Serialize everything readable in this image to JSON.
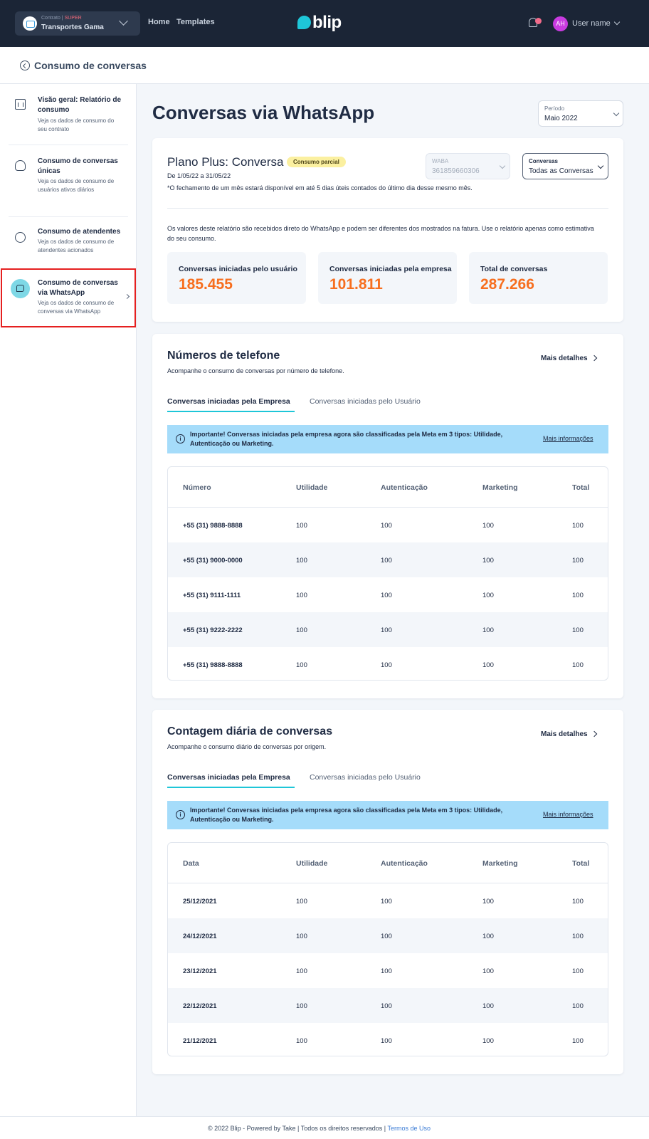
{
  "header": {
    "contract_label": "Contrato |",
    "contract_tier": "SUPER",
    "contract_name": "Transportes Gama",
    "nav": [
      "Home",
      "Templates"
    ],
    "logo": "blip",
    "avatar_initials": "AH",
    "username": "User name"
  },
  "breadcrumb": {
    "title": "Consumo de conversas"
  },
  "sidebar": {
    "items": [
      {
        "title": "Visão geral: Relatório de consumo",
        "desc": "Veja os dados de consumo do seu contrato"
      },
      {
        "title": "Consumo de conversas únicas",
        "desc": "Veja os dados de consumo de usuários ativos diários"
      },
      {
        "title": "Consumo de atendentes",
        "desc": "Veja os dados de consumo de atendentes acionados"
      },
      {
        "title": "Consumo de conversas via WhatsApp",
        "desc": "Veja os dados de consumo de conversas via WhatsApp"
      }
    ]
  },
  "page": {
    "title": "Conversas via WhatsApp",
    "period": {
      "label": "Período",
      "value": "Maio 2022"
    }
  },
  "plan": {
    "title": "Plano Plus: Conversa",
    "badge": "Consumo parcial",
    "range": "De 1/05/22 a 31/05/22",
    "note": "*O fechamento de um mês estará disponível em até 5 dias úteis contados do último dia desse mesmo mês.",
    "waba": {
      "label": "WABA",
      "value": "361859660306"
    },
    "conversas": {
      "label": "Conversas",
      "value": "Todas as Conversas"
    },
    "disclaimer": "Os valores deste relatório são recebidos direto do WhatsApp e podem ser diferentes dos mostrados na fatura. Use o relatório apenas como estimativa do seu consumo.",
    "stats": [
      {
        "label": "Conversas iniciadas pelo usuário",
        "value": "185.455"
      },
      {
        "label": "Conversas iniciadas pela empresa",
        "value": "101.811"
      },
      {
        "label": "Total de conversas",
        "value": "287.266"
      }
    ]
  },
  "phones": {
    "title": "Números de telefone",
    "subtitle": "Acompanhe o consumo de conversas por número de telefone.",
    "more": "Mais detalhes",
    "tabs": [
      "Conversas iniciadas pela Empresa",
      "Conversas iniciadas pelo Usuário"
    ],
    "info": "Importante! Conversas iniciadas pela empresa agora são classificadas pela Meta em 3 tipos: Utilidade, Autenticação ou Marketing.",
    "info_link": "Mais informações",
    "columns": [
      "Número",
      "Utilidade",
      "Autenticação",
      "Marketing",
      "Total"
    ],
    "rows": [
      [
        "+55 (31) 9888-8888",
        "100",
        "100",
        "100",
        "100"
      ],
      [
        "+55 (31) 9000-0000",
        "100",
        "100",
        "100",
        "100"
      ],
      [
        "+55 (31) 9111-1111",
        "100",
        "100",
        "100",
        "100"
      ],
      [
        "+55 (31) 9222-2222",
        "100",
        "100",
        "100",
        "100"
      ],
      [
        "+55 (31) 9888-8888",
        "100",
        "100",
        "100",
        "100"
      ]
    ]
  },
  "daily": {
    "title": "Contagem diária de conversas",
    "subtitle": "Acompanhe o consumo diário de conversas por origem.",
    "more": "Mais detalhes",
    "tabs": [
      "Conversas iniciadas pela Empresa",
      "Conversas iniciadas pelo Usuário"
    ],
    "info": "Importante! Conversas iniciadas pela empresa agora são classificadas pela Meta em 3 tipos: Utilidade, Autenticação ou Marketing.",
    "info_link": "Mais informações",
    "columns": [
      "Data",
      "Utilidade",
      "Autenticação",
      "Marketing",
      "Total"
    ],
    "rows": [
      [
        "25/12/2021",
        "100",
        "100",
        "100",
        "100"
      ],
      [
        "24/12/2021",
        "100",
        "100",
        "100",
        "100"
      ],
      [
        "23/12/2021",
        "100",
        "100",
        "100",
        "100"
      ],
      [
        "22/12/2021",
        "100",
        "100",
        "100",
        "100"
      ],
      [
        "21/12/2021",
        "100",
        "100",
        "100",
        "100"
      ]
    ]
  },
  "footer": {
    "text": "© 2022 Blip - Powered by Take | Todos os direitos reservados |",
    "link": "Termos de Uso"
  }
}
